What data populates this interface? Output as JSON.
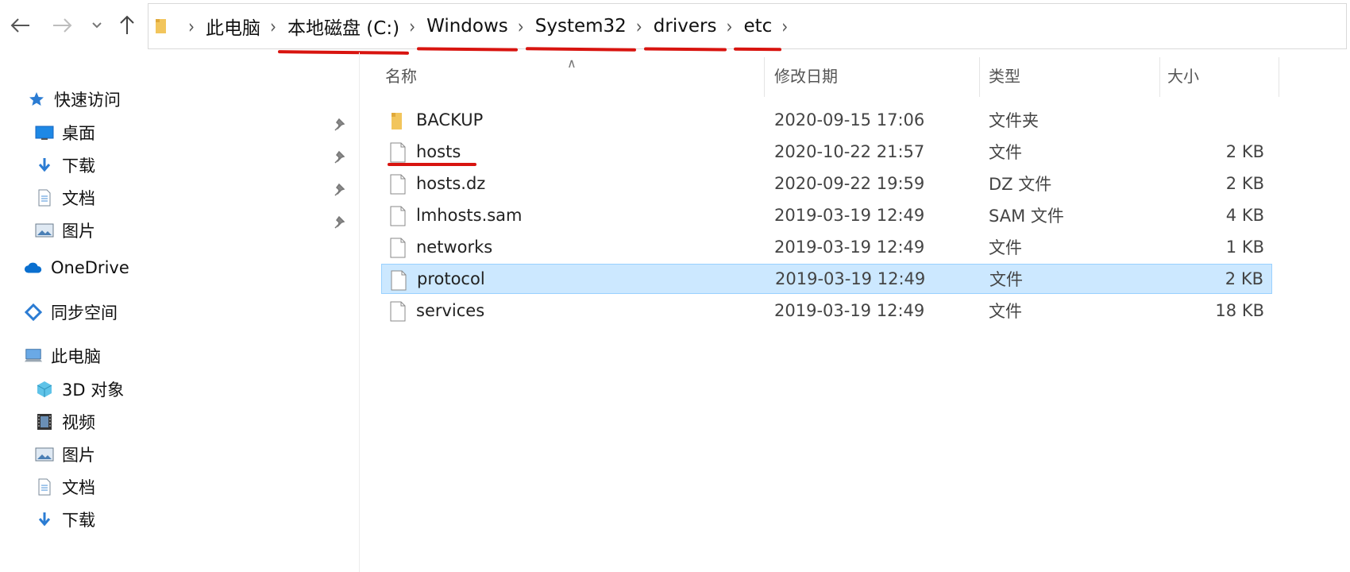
{
  "address_bar": {
    "crumbs": [
      "此电脑",
      "本地磁盘 (C:)",
      "Windows",
      "System32",
      "drivers",
      "etc"
    ]
  },
  "nav": {
    "back_icon": "arrow-left-icon",
    "forward_icon": "arrow-right-icon",
    "recent_icon": "chevron-down-icon",
    "up_icon": "arrow-up-icon"
  },
  "sidebar": {
    "quick_access": "快速访问",
    "quick_items": [
      {
        "label": "桌面",
        "icon": "desktop-icon"
      },
      {
        "label": "下载",
        "icon": "download-icon"
      },
      {
        "label": "文档",
        "icon": "document-icon"
      },
      {
        "label": "图片",
        "icon": "picture-icon"
      }
    ],
    "onedrive": "OneDrive",
    "sync": "同步空间",
    "this_pc": "此电脑",
    "pc_items": [
      {
        "label": "3D 对象",
        "icon": "3d-objects-icon"
      },
      {
        "label": "视频",
        "icon": "video-icon"
      },
      {
        "label": "图片",
        "icon": "picture-icon"
      },
      {
        "label": "文档",
        "icon": "document-icon"
      },
      {
        "label": "下载",
        "icon": "download-icon"
      }
    ]
  },
  "columns": {
    "name": "名称",
    "date": "修改日期",
    "type": "类型",
    "size": "大小"
  },
  "files": [
    {
      "name": "BACKUP",
      "date": "2020-09-15 17:06",
      "type": "文件夹",
      "size": "",
      "icon": "folder-icon"
    },
    {
      "name": "hosts",
      "date": "2020-10-22 21:57",
      "type": "文件",
      "size": "2 KB",
      "icon": "file-icon"
    },
    {
      "name": "hosts.dz",
      "date": "2020-09-22 19:59",
      "type": "DZ 文件",
      "size": "2 KB",
      "icon": "file-icon"
    },
    {
      "name": "lmhosts.sam",
      "date": "2019-03-19 12:49",
      "type": "SAM 文件",
      "size": "4 KB",
      "icon": "file-icon"
    },
    {
      "name": "networks",
      "date": "2019-03-19 12:49",
      "type": "文件",
      "size": "1 KB",
      "icon": "file-icon"
    },
    {
      "name": "protocol",
      "date": "2019-03-19 12:49",
      "type": "文件",
      "size": "2 KB",
      "icon": "file-icon"
    },
    {
      "name": "services",
      "date": "2019-03-19 12:49",
      "type": "文件",
      "size": "18 KB",
      "icon": "file-icon"
    }
  ],
  "colors": {
    "selection": "#cce8ff",
    "annotation": "#d8140f",
    "folder": "#f2c55c"
  }
}
